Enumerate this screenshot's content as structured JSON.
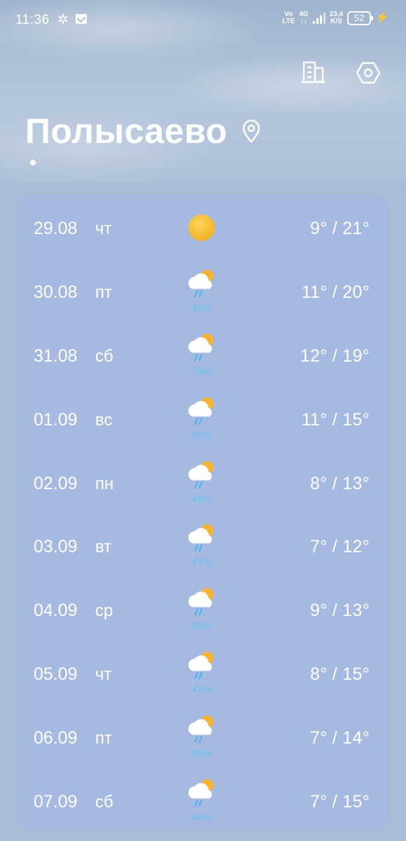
{
  "status_bar": {
    "time": "11:36",
    "volte": "Vo\nLTE",
    "network": "4G",
    "speed": "23,4\nK/S",
    "battery": "52"
  },
  "header": {
    "city": "Полысаево"
  },
  "colors": {
    "card": "#a6b9e0",
    "precip": "#5ec4f3",
    "sun": "#f5b324"
  },
  "forecast": [
    {
      "date": "29.08",
      "dow": "чт",
      "icon": "sun-icon",
      "precip": "",
      "temps": "9° / 21°"
    },
    {
      "date": "30.08",
      "dow": "пт",
      "icon": "rain-icon",
      "precip": "41%",
      "temps": "11° / 20°"
    },
    {
      "date": "31.08",
      "dow": "сб",
      "icon": "rain-icon",
      "precip": "75%",
      "temps": "12° / 19°"
    },
    {
      "date": "01.09",
      "dow": "вс",
      "icon": "rain-icon",
      "precip": "61%",
      "temps": "11° / 15°"
    },
    {
      "date": "02.09",
      "dow": "пн",
      "icon": "rain-icon",
      "precip": "45%",
      "temps": "8° / 13°"
    },
    {
      "date": "03.09",
      "dow": "вт",
      "icon": "rain-icon",
      "precip": "47%",
      "temps": "7° / 12°"
    },
    {
      "date": "04.09",
      "dow": "ср",
      "icon": "rain-icon",
      "precip": "65%",
      "temps": "9° / 13°"
    },
    {
      "date": "05.09",
      "dow": "чт",
      "icon": "rain-icon",
      "precip": "47%",
      "temps": "8° / 15°"
    },
    {
      "date": "06.09",
      "dow": "пт",
      "icon": "rain-icon",
      "precip": "60%",
      "temps": "7° / 14°"
    },
    {
      "date": "07.09",
      "dow": "сб",
      "icon": "rain-icon",
      "precip": "44%",
      "temps": "7° / 15°"
    }
  ]
}
